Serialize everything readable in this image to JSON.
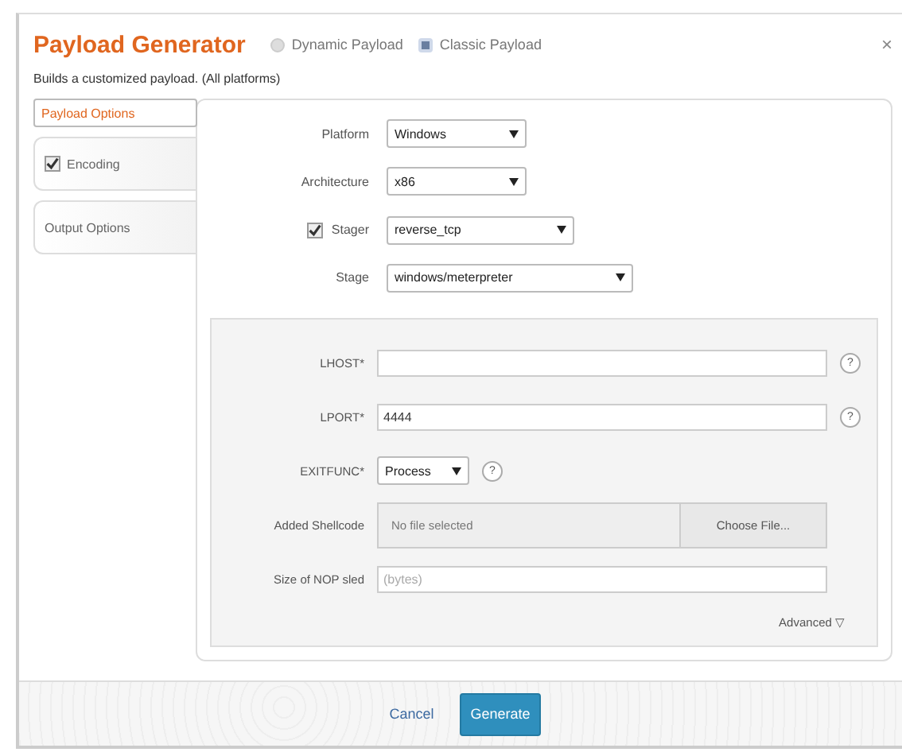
{
  "title": "Payload Generator",
  "modes": [
    {
      "label": "Dynamic Payload",
      "selected": false
    },
    {
      "label": "Classic Payload",
      "selected": true
    }
  ],
  "close": "×",
  "subtitle": "Builds a customized payload. (All platforms)",
  "tabs": [
    {
      "label": "Payload Options",
      "selected": true
    },
    {
      "label": "Encoding",
      "selected": false,
      "checked": true
    },
    {
      "label": "Output Options",
      "selected": false
    }
  ],
  "options": [
    {
      "label": "Platform",
      "value": "Windows"
    },
    {
      "label": "Architecture",
      "value": "x86"
    },
    {
      "label": "Stager",
      "value": "reverse_tcp",
      "checked": true
    },
    {
      "label": "Stage",
      "value": "windows/meterpreter"
    }
  ],
  "settings": [
    {
      "kind": "text",
      "label": "LHOST*",
      "help": "?"
    },
    {
      "kind": "text",
      "label": "LPORT*",
      "value": "4444",
      "help": "?"
    },
    {
      "kind": "select",
      "label": "EXITFUNC*",
      "value": "Process",
      "help": "?"
    },
    {
      "kind": "file",
      "label": "Added Shellcode",
      "placeholder": "No file selected",
      "button": "Choose File..."
    },
    {
      "kind": "text",
      "label": "Size of NOP sled",
      "placeholder": "(bytes)"
    }
  ],
  "advanced": "Advanced ▽",
  "buttons": [
    {
      "label": "Cancel",
      "kind": "link"
    },
    {
      "label": "Generate",
      "kind": "primary"
    }
  ]
}
